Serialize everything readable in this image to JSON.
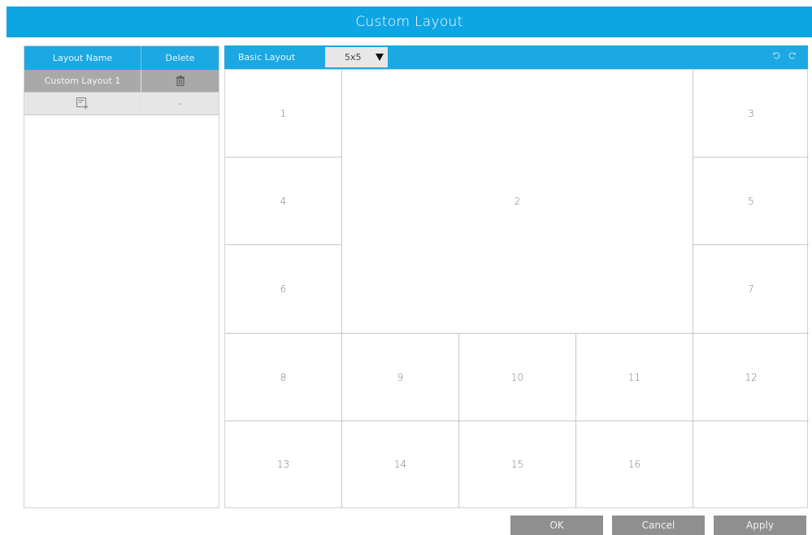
{
  "window": {
    "title": "Custom Layout"
  },
  "layout_list": {
    "headers": {
      "name": "Layout Name",
      "delete": "Delete"
    },
    "rows": [
      {
        "name": "Custom Layout 1",
        "delete_icon": "trash-icon"
      }
    ],
    "add_row": {
      "add_icon": "add-layout-icon",
      "delete_placeholder": "-"
    }
  },
  "editor": {
    "basic_layout_label": "Basic Layout",
    "basic_layout_value": "5x5",
    "tools": {
      "undo_icon": "undo-icon",
      "redo_icon": "redo-icon"
    },
    "cells": [
      "1",
      "2",
      "3",
      "4",
      "5",
      "6",
      "7",
      "8",
      "9",
      "10",
      "11",
      "12",
      "13",
      "14",
      "15",
      "16",
      ""
    ]
  },
  "buttons": {
    "ok": "OK",
    "cancel": "Cancel",
    "apply": "Apply"
  },
  "colors": {
    "accent": "#1ba8e3",
    "title_bar": "#0ea5e4",
    "button": "#8f8f8f",
    "selected_row": "#a9a9a9"
  }
}
